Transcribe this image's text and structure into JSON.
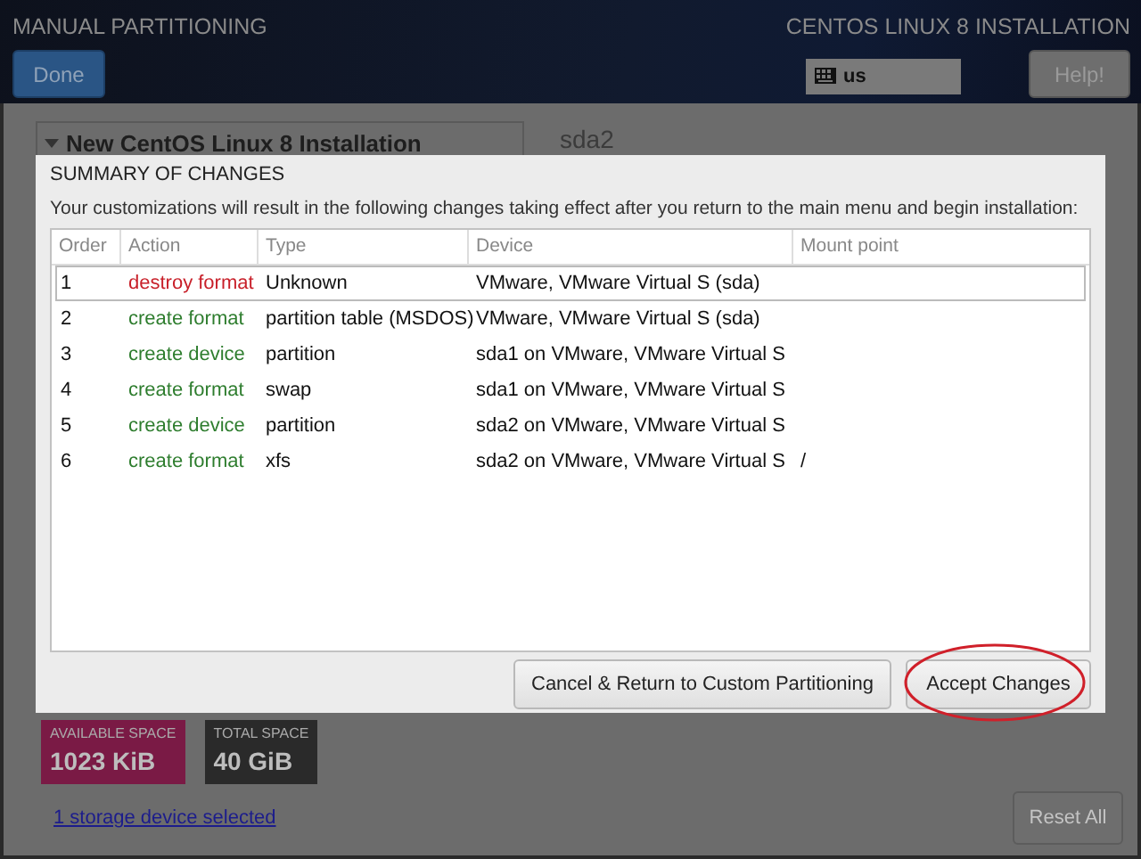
{
  "header": {
    "title": "MANUAL PARTITIONING",
    "done_button": "Done",
    "product": "CENTOS LINUX 8 INSTALLATION",
    "keyboard_layout": "us",
    "help_button": "Help!"
  },
  "background": {
    "installation_header": "New CentOS Linux 8 Installation",
    "device_title": "sda2",
    "available_space": {
      "label": "AVAILABLE SPACE",
      "value": "1023 KiB"
    },
    "total_space": {
      "label": "TOTAL SPACE",
      "value": "40 GiB"
    },
    "storage_link": "1 storage device selected",
    "reset_button": "Reset All"
  },
  "dialog": {
    "title": "SUMMARY OF CHANGES",
    "description": "Your customizations will result in the following changes taking effect after you return to the main menu and begin installation:",
    "table": {
      "columns": [
        "Order",
        "Action",
        "Type",
        "Device",
        "Mount point"
      ],
      "rows": [
        {
          "order": "1",
          "action": "destroy format",
          "kind": "destroy",
          "type": "Unknown",
          "device": "VMware, VMware Virtual S (sda)",
          "mount_point": "",
          "selected": true
        },
        {
          "order": "2",
          "action": "create format",
          "kind": "create",
          "type": "partition table (MSDOS)",
          "device": "VMware, VMware Virtual S (sda)",
          "mount_point": "",
          "selected": false
        },
        {
          "order": "3",
          "action": "create device",
          "kind": "create",
          "type": "partition",
          "device": "sda1 on VMware, VMware Virtual S",
          "mount_point": "",
          "selected": false
        },
        {
          "order": "4",
          "action": "create format",
          "kind": "create",
          "type": "swap",
          "device": "sda1 on VMware, VMware Virtual S",
          "mount_point": "",
          "selected": false
        },
        {
          "order": "5",
          "action": "create device",
          "kind": "create",
          "type": "partition",
          "device": "sda2 on VMware, VMware Virtual S",
          "mount_point": "",
          "selected": false
        },
        {
          "order": "6",
          "action": "create format",
          "kind": "create",
          "type": "xfs",
          "device": "sda2 on VMware, VMware Virtual S",
          "mount_point": "/",
          "selected": false
        }
      ]
    },
    "buttons": [
      "Cancel & Return to Custom Partitioning",
      "Accept Changes"
    ]
  }
}
